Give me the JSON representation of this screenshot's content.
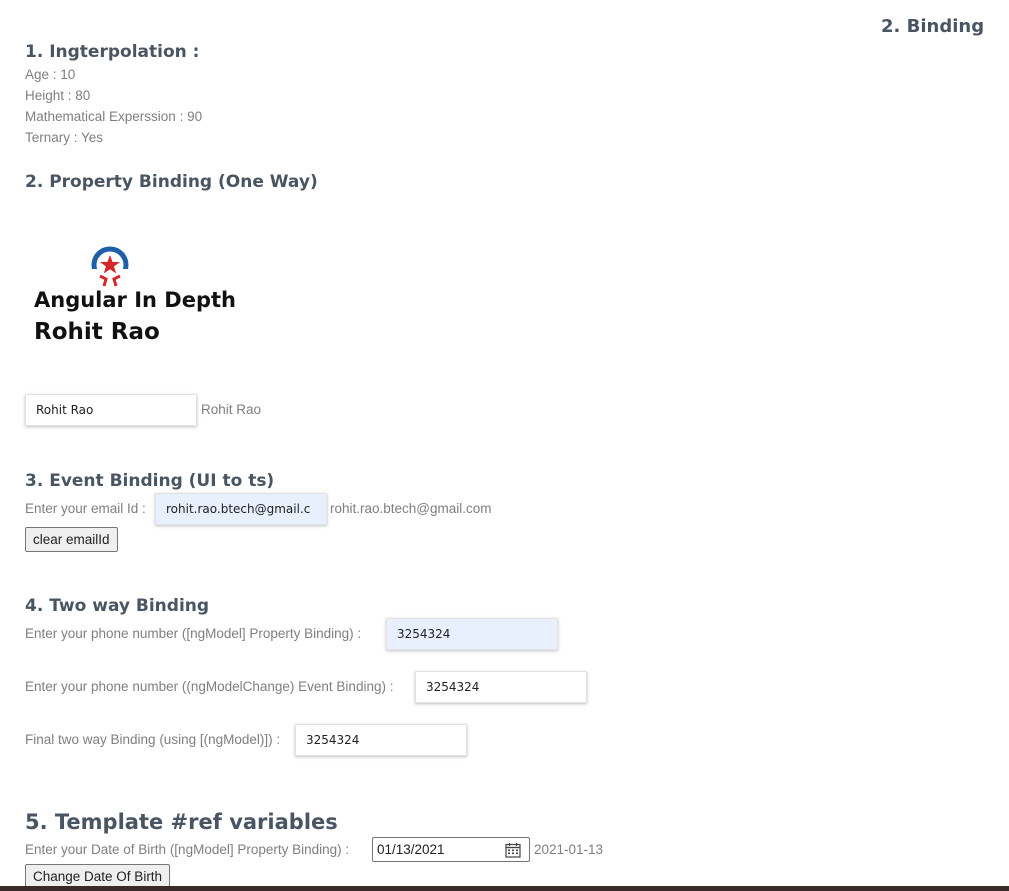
{
  "header": {
    "right_title": "2. Binding"
  },
  "interpolation": {
    "heading": "1. Ingterpolation :",
    "lines": [
      "Age : 10",
      "Height : 80",
      "Mathematical Experssion : 90",
      "Ternary : Yes"
    ]
  },
  "property_binding": {
    "heading": "2. Property Binding (One Way)",
    "logo_line1": "Angular In Depth",
    "logo_line2": "Rohit Rao",
    "input_value": "Rohit Rao",
    "output_text": "Rohit Rao"
  },
  "event_binding": {
    "heading": "3. Event Binding (UI to ts)",
    "label": "Enter your email Id :",
    "input_value": "rohit.rao.btech@gmail.c",
    "output_text": "rohit.rao.btech@gmail.com",
    "button_label": "clear emailId"
  },
  "two_way": {
    "heading": "4. Two way Binding",
    "row1_label": "Enter your phone number ([ngModel] Property Binding) :",
    "row1_value": "3254324",
    "row2_label": "Enter your phone number ((ngModelChange) Event Binding) :",
    "row2_value": "3254324",
    "row3_label": "Final two way Binding (using [(ngModel)]) :",
    "row3_value": "3254324"
  },
  "template_ref": {
    "heading": "5. Template #ref variables",
    "label": "Enter your Date of Birth ([ngModel] Property Binding) :",
    "date_value": "01/13/2021",
    "output_text": "2021-01-13",
    "button_label": "Change Date Of Birth"
  },
  "colors": {
    "heading": "#4a5563",
    "autofill": "#e8f0fe",
    "logo_ring": "#1f5fa8",
    "logo_star": "#d62828"
  },
  "icons": {
    "logo": "angular-in-depth-logo-icon",
    "calendar": "calendar-icon"
  }
}
